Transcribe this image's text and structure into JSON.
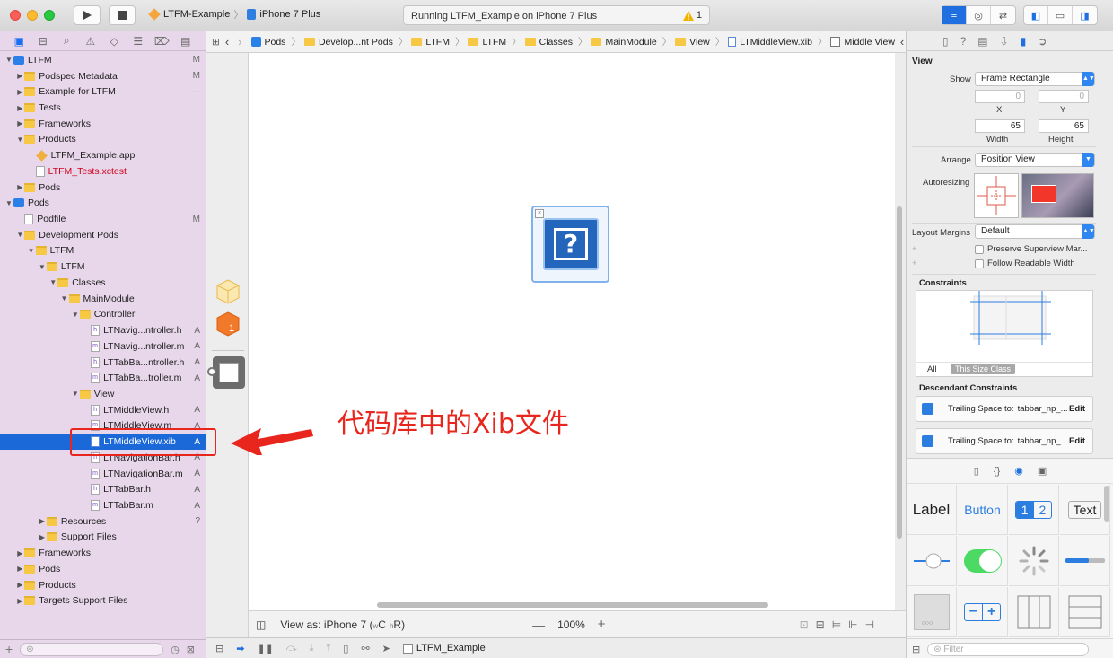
{
  "toolbar": {
    "scheme_name": "LTFM-Example",
    "device": "iPhone 7 Plus",
    "activity": "Running LTFM_Example on iPhone 7 Plus",
    "warning_count": "1"
  },
  "navigator": {
    "items": [
      {
        "label": "LTFM",
        "level": 0,
        "kind": "proj",
        "open": true,
        "status": "M"
      },
      {
        "label": "Podspec Metadata",
        "level": 1,
        "kind": "folder",
        "open": false,
        "status": "M"
      },
      {
        "label": "Example for LTFM",
        "level": 1,
        "kind": "folder",
        "open": false,
        "status": "—"
      },
      {
        "label": "Tests",
        "level": 1,
        "kind": "folder",
        "open": false,
        "status": ""
      },
      {
        "label": "Frameworks",
        "level": 1,
        "kind": "folder",
        "open": false,
        "status": ""
      },
      {
        "label": "Products",
        "level": 1,
        "kind": "folder",
        "open": true,
        "status": ""
      },
      {
        "label": "LTFM_Example.app",
        "level": 2,
        "kind": "app",
        "status": ""
      },
      {
        "label": "LTFM_Tests.xctest",
        "level": 2,
        "kind": "file",
        "red": true,
        "status": ""
      },
      {
        "label": "Pods",
        "level": 1,
        "kind": "folder",
        "open": false,
        "status": ""
      },
      {
        "label": "Pods",
        "level": 0,
        "kind": "proj",
        "open": true,
        "status": ""
      },
      {
        "label": "Podfile",
        "level": 1,
        "kind": "file",
        "status": "M"
      },
      {
        "label": "Development Pods",
        "level": 1,
        "kind": "folder",
        "open": true,
        "status": ""
      },
      {
        "label": "LTFM",
        "level": 2,
        "kind": "folder",
        "open": true,
        "status": ""
      },
      {
        "label": "LTFM",
        "level": 3,
        "kind": "folder",
        "open": true,
        "status": ""
      },
      {
        "label": "Classes",
        "level": 4,
        "kind": "folder",
        "open": true,
        "status": ""
      },
      {
        "label": "MainModule",
        "level": 5,
        "kind": "folder",
        "open": true,
        "status": ""
      },
      {
        "label": "Controller",
        "level": 6,
        "kind": "folder",
        "open": true,
        "status": ""
      },
      {
        "label": "LTNavig...ntroller.h",
        "level": 7,
        "kind": "h",
        "status": "A"
      },
      {
        "label": "LTNavig...ntroller.m",
        "level": 7,
        "kind": "m",
        "status": "A"
      },
      {
        "label": "LTTabBa...ntroller.h",
        "level": 7,
        "kind": "h",
        "status": "A"
      },
      {
        "label": "LTTabBa...troller.m",
        "level": 7,
        "kind": "m",
        "status": "A"
      },
      {
        "label": "View",
        "level": 6,
        "kind": "folder",
        "open": true,
        "status": ""
      },
      {
        "label": "LTMiddleView.h",
        "level": 7,
        "kind": "h",
        "status": "A"
      },
      {
        "label": "LTMiddleView.m",
        "level": 7,
        "kind": "m",
        "status": "A"
      },
      {
        "label": "LTMiddleView.xib",
        "level": 7,
        "kind": "xib",
        "status": "A",
        "selected": true
      },
      {
        "label": "LTNavigationBar.h",
        "level": 7,
        "kind": "h",
        "status": "A"
      },
      {
        "label": "LTNavigationBar.m",
        "level": 7,
        "kind": "m",
        "status": "A"
      },
      {
        "label": "LTTabBar.h",
        "level": 7,
        "kind": "h",
        "status": "A"
      },
      {
        "label": "LTTabBar.m",
        "level": 7,
        "kind": "m",
        "status": "A"
      },
      {
        "label": "Resources",
        "level": 3,
        "kind": "folder",
        "open": false,
        "status": "?"
      },
      {
        "label": "Support Files",
        "level": 3,
        "kind": "folder",
        "open": false,
        "status": ""
      },
      {
        "label": "Frameworks",
        "level": 1,
        "kind": "folder",
        "open": false,
        "status": ""
      },
      {
        "label": "Pods",
        "level": 1,
        "kind": "folder",
        "open": false,
        "status": ""
      },
      {
        "label": "Products",
        "level": 1,
        "kind": "folder",
        "open": false,
        "status": ""
      },
      {
        "label": "Targets Support Files",
        "level": 1,
        "kind": "folder",
        "open": false,
        "status": ""
      }
    ]
  },
  "jumpbar": {
    "crumbs": [
      "Pods",
      "Develop...nt Pods",
      "LTFM",
      "LTFM",
      "Classes",
      "MainModule",
      "View",
      "LTMiddleView.xib",
      "Middle View"
    ]
  },
  "annotation": {
    "text": "代码库中的Xib文件",
    "color": "#e8261e"
  },
  "canvas_footer": {
    "view_as": "View as: iPhone 7 (",
    "size_class_w": "w",
    "size_class_w_val": "C",
    "size_class_h": "h",
    "size_class_h_val": "R)",
    "zoom": "100%"
  },
  "debugbar": {
    "target": "LTFM_Example"
  },
  "inspector": {
    "section_title": "View",
    "show_label": "Show",
    "show_value": "Frame Rectangle",
    "x_value": "0",
    "y_value": "0",
    "x_label": "X",
    "y_label": "Y",
    "width_value": "65",
    "height_value": "65",
    "width_label": "Width",
    "height_label": "Height",
    "arrange_label": "Arrange",
    "arrange_value": "Position View",
    "autoresizing_label": "Autoresizing",
    "margins_label": "Layout Margins",
    "margins_value": "Default",
    "preserve_label": "Preserve Superview Mar...",
    "readable_label": "Follow Readable Width",
    "constraints_title": "Constraints",
    "tab_all": "All",
    "tab_size_class": "This Size Class",
    "descendant_title": "Descendant Constraints",
    "constraint_1": "Trailing Space to:",
    "constraint_1_target": "tabbar_np_...",
    "constraint_2": "Trailing Space to:",
    "constraint_2_target": "tabbar_np_...",
    "edit_label": "Edit"
  },
  "library": {
    "label_item": "Label",
    "button_item": "Button",
    "seg_1": "1",
    "seg_2": "2",
    "text_item": "Text",
    "filter_placeholder": "Filter"
  }
}
